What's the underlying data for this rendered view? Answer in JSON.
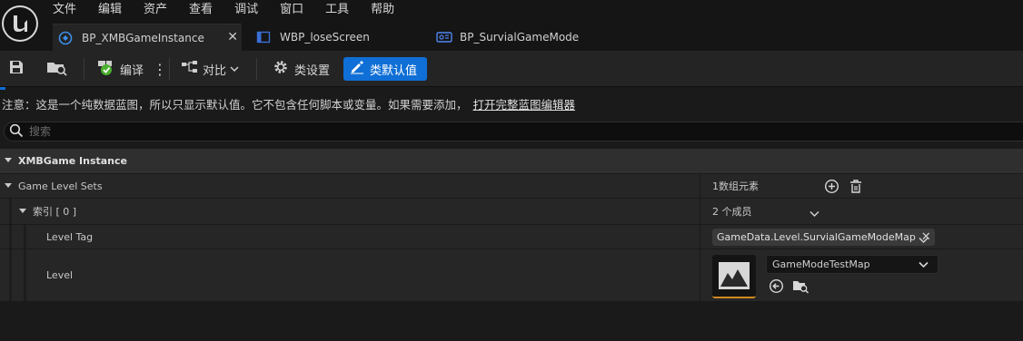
{
  "menu": [
    "文件",
    "编辑",
    "资产",
    "查看",
    "调试",
    "窗口",
    "工具",
    "帮助"
  ],
  "tabs": [
    {
      "label": "BP_XMBGameInstance",
      "active": true
    },
    {
      "label": "WBP_loseScreen",
      "active": false
    },
    {
      "label": "BP_SurvialGameMode",
      "active": false
    }
  ],
  "toolbar": {
    "compile_label": "编译",
    "diff_label": "对比",
    "class_settings_label": "类设置",
    "class_defaults_label": "类默认值"
  },
  "notice": {
    "text": "注意：这是一个纯数据蓝图，所以只显示默认值。它不包含任何脚本或变量。如果需要添加，",
    "link": "打开完整蓝图编辑器"
  },
  "search": {
    "placeholder": "搜索"
  },
  "details": {
    "section_title": "XMBGame Instance",
    "rows": [
      {
        "name": "Game Level Sets",
        "value": "1数组元素"
      },
      {
        "name": "索引 [ 0 ]",
        "value": "2 个成员"
      },
      {
        "name": "Level Tag",
        "value": "GameData.Level.SurvialGameModeMap"
      },
      {
        "name": "Level",
        "value": "GameModeTestMap"
      }
    ]
  },
  "colors": {
    "accent": "#0f6fd6",
    "thumb_underline": "#d08a1e",
    "panel": "#262626",
    "header": "#2f2f2f"
  },
  "icons": [
    "unreal-logo-icon",
    "blueprint-icon",
    "widget-blueprint-icon",
    "gamemode-blueprint-icon",
    "save-icon",
    "browse-icon",
    "compile-check-icon",
    "more-icon",
    "diff-icon",
    "gear-icon",
    "edit-pencil-icon",
    "search-icon",
    "add-element-icon",
    "delete-icon",
    "clear-x-icon",
    "chevron-down-icon",
    "use-selected-arrow-icon",
    "browse-folder-icon",
    "level-thumbnail-icon"
  ]
}
